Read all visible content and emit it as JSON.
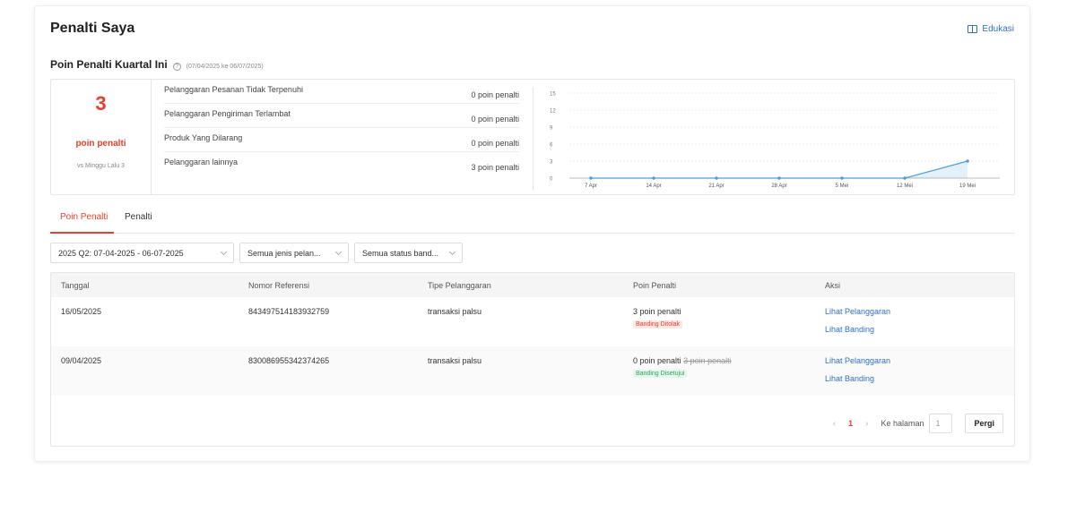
{
  "header": {
    "title": "Penalti Saya",
    "edu_label": "Edukasi"
  },
  "quarter": {
    "title": "Poin Penalti Kuartal Ini",
    "range": "(07/04/2025 ke 06/07/2025)"
  },
  "score": {
    "value": "3",
    "unit": "poin penalti",
    "compare": "vs Minggu Lalu 3"
  },
  "categories": [
    {
      "label": "Pelanggaran Pesanan Tidak Terpenuhi",
      "points": "0 poin penalti"
    },
    {
      "label": "Pelanggaran Pengiriman Terlambat",
      "points": "0 poin penalti"
    },
    {
      "label": "Produk Yang Dilarang",
      "points": "0 poin penalti"
    },
    {
      "label": "Pelanggaran lainnya",
      "points": "3 poin penalti"
    }
  ],
  "chart_data": {
    "type": "area",
    "x": [
      "7 Apr",
      "14 Apr",
      "21 Apr",
      "28 Apr",
      "5 Mei",
      "12 Mei",
      "19 Mei"
    ],
    "y_ticks": [
      0,
      3,
      6,
      9,
      12,
      15
    ],
    "ylim": [
      0,
      15
    ],
    "series": [
      {
        "values": [
          0,
          0,
          0,
          0,
          0,
          0,
          3
        ]
      }
    ],
    "color": "#4a9fe0",
    "grid": true
  },
  "tabs": [
    {
      "label": "Poin Penalti"
    },
    {
      "label": "Penalti"
    }
  ],
  "filters": {
    "period": "2025 Q2: 07-04-2025 - 06-07-2025",
    "type": "Semua jenis pelan...",
    "status": "Semua status band..."
  },
  "table": {
    "columns": [
      "Tanggal",
      "Nomor Referensi",
      "Tipe Pelanggaran",
      "Poin Penalti",
      "Aksi"
    ],
    "rows": [
      {
        "date": "16/05/2025",
        "ref": "843497514183932759",
        "type": "transaksi palsu",
        "points": "3 poin penalti",
        "old_points": "",
        "badge": "Banding Ditolak",
        "action1": "Lihat Pelanggaran",
        "action2": "Lihat Banding"
      },
      {
        "date": "09/04/2025",
        "ref": "830086955342374265",
        "type": "transaksi palsu",
        "points": "0 poin penalti",
        "old_points": "3 poin penalti",
        "badge": "Banding Disetujui",
        "action1": "Lihat Pelanggaran",
        "action2": "Lihat Banding"
      }
    ]
  },
  "pager": {
    "current": "1",
    "goto_label": "Ke halaman",
    "goto_value": "1",
    "go_button": "Pergi",
    "prev_icon": "‹",
    "next_icon": "›"
  },
  "colors": {
    "accent": "#e5412d",
    "link": "#2f6fc9",
    "chart_line": "#4a9fe0"
  }
}
